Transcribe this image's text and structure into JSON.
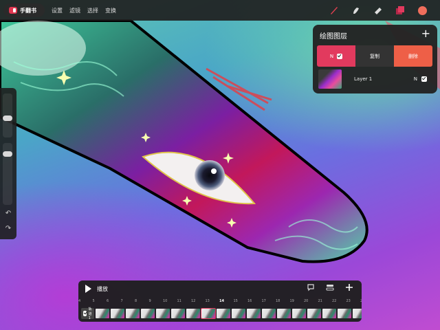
{
  "app": {
    "title": "手翻书"
  },
  "menu": [
    {
      "name": "menu-settings",
      "label": "设置"
    },
    {
      "name": "menu-adjustments",
      "label": "滤镜"
    },
    {
      "name": "menu-selection",
      "label": "选择"
    },
    {
      "name": "menu-transform",
      "label": "变换"
    }
  ],
  "tools": [
    {
      "name": "brush-tool",
      "icon": "brush-icon",
      "color": "#e04050"
    },
    {
      "name": "smudge-tool",
      "icon": "smudge-icon",
      "color": "#dddddd"
    },
    {
      "name": "eraser-tool",
      "icon": "eraser-icon",
      "color": "#dddddd"
    },
    {
      "name": "layers-tool",
      "icon": "layers-icon",
      "color": "#e23a5e"
    },
    {
      "name": "color-tool",
      "icon": "color-swatch",
      "color": "#f06e5c"
    }
  ],
  "layers_panel": {
    "title": "绘图图层",
    "add_icon": "plus-icon",
    "actions": {
      "mode_label": "N",
      "duplicate_label": "复制",
      "delete_label": "删除"
    },
    "layers": [
      {
        "name": "Layer 1",
        "mode": "N",
        "visible": true
      }
    ]
  },
  "sidebar": {
    "undo_icon": "undo-icon",
    "redo_icon": "redo-icon"
  },
  "timeline": {
    "play_label": "播放",
    "icons": [
      "comment-icon",
      "onion-skin-icon",
      "plus-icon"
    ],
    "frame_numbers": [
      "4",
      "5",
      "6",
      "7",
      "8",
      "9",
      "10",
      "11",
      "12",
      "13",
      "14",
      "15",
      "16",
      "17",
      "18",
      "19",
      "20",
      "21",
      "22",
      "23",
      "24"
    ],
    "current_frame": "14",
    "track_label": "轨道 1",
    "frame_count": 18
  },
  "colors": {
    "accent": "#e23a5e",
    "delete": "#ee5f47",
    "panel_bg": "#222222"
  }
}
